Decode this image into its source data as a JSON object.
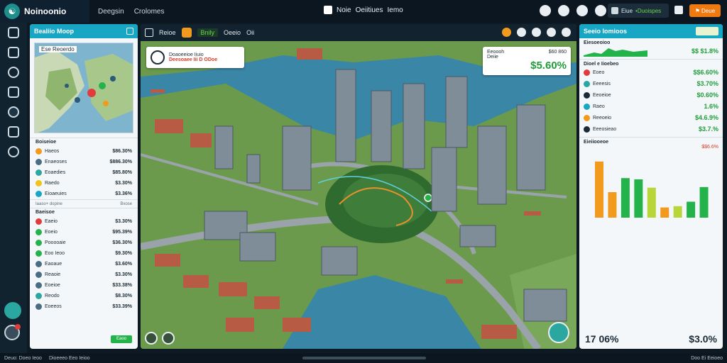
{
  "app": {
    "name": "Noinoonio",
    "nav": [
      "Deegsin",
      "Crolomes"
    ]
  },
  "header": {
    "title_a": "Noie",
    "title_b": "Oeiitiues",
    "title_c": "Iemo",
    "user_label": "Eiue",
    "user_status": "•Duoispes",
    "action_label": "Deue"
  },
  "left_panel": {
    "title": "Bealiio Moop",
    "minimap_label": "Ese Reoerdo",
    "section_a_title": "Boiseioe",
    "metrics_a": [
      {
        "label": "Haeos",
        "value": "$86.30%",
        "color": "#f29a1d"
      },
      {
        "label": "Enaeoses",
        "value": "$886.30%",
        "color": "#4a6d84"
      },
      {
        "label": "Eoaedies",
        "value": "$85.80%",
        "color": "#2aa7a0"
      },
      {
        "label": "Raedo",
        "value": "$3.30%",
        "color": "#f2c21d"
      },
      {
        "label": "Eioaeuies",
        "value": "$3.36%",
        "color": "#17a7c4"
      }
    ],
    "footer_a_left": "Iaaso+ dopine",
    "footer_a_right": "Bxose",
    "section_b_title": "Baeisoe",
    "metrics_b": [
      {
        "label": "Eaeio",
        "value": "$3.30%",
        "color": "#e23b3b"
      },
      {
        "label": "Eoeio",
        "value": "$95.39%",
        "color": "#24b24a"
      },
      {
        "label": "Pooooaie",
        "value": "$36.30%",
        "color": "#24b24a"
      },
      {
        "label": "Eoo Ieoo",
        "value": "$9.30%",
        "color": "#24b24a"
      },
      {
        "label": "Eaoaue",
        "value": "$3.60%",
        "color": "#4a6d84"
      },
      {
        "label": "Reaoie",
        "value": "$3.30%",
        "color": "#4a6d84"
      },
      {
        "label": "Eoeioe",
        "value": "$33.38%",
        "color": "#4a6d84"
      },
      {
        "label": "Reodo",
        "value": "$8.30%",
        "color": "#2aa7a0"
      },
      {
        "label": "Eoeeos",
        "value": "$33.39%",
        "color": "#4a6d84"
      }
    ],
    "button_label": "Eaoo"
  },
  "map": {
    "toolbar": [
      "Reioe",
      "Bnily",
      "Oeeio",
      "Oii"
    ],
    "callout_left": {
      "line1": "Doaoeeioe  Iiuio",
      "line2": "Deesoaee  Iii D ODoe"
    },
    "callout_right": {
      "line1": "Eeoooh",
      "value1": "$60 860",
      "line2": "Deiie",
      "big": "$5.60%"
    }
  },
  "right_panel": {
    "title": "Seeio Iomioos",
    "block1_title": "Eiesoeoioo",
    "block1_value": "$$ $1.8%",
    "block2_title": "Dioel e Iioebeo",
    "rows": [
      {
        "label": "Eoeo",
        "value": "$$6.60%"
      },
      {
        "label": "Eeeesis",
        "value": "$3.70%"
      },
      {
        "label": "Eeoeioe",
        "value": "$0.60%"
      },
      {
        "label": "Raeo",
        "value": "1.6%"
      },
      {
        "label": "Reeoeio",
        "value": "$4.6.9%"
      },
      {
        "label": "Eeeosieao",
        "value": "$3.7.%"
      }
    ],
    "chart_title": "Eieiiooeoe",
    "chart_values": [
      88,
      40,
      62,
      60,
      47,
      16,
      18,
      25,
      48
    ],
    "chart_colors": [
      "#f29a1d",
      "#f29a1d",
      "#24b24a",
      "#24b24a",
      "#b8d63a",
      "#f29a1d",
      "#b8d63a",
      "#24b24a",
      "#24b24a"
    ],
    "chart_legend": "$$6.6%",
    "bottom_left": "17 06%",
    "bottom_right": "$3.0%"
  },
  "statusbar": {
    "left1": "Deuo: Doeo Ieoo",
    "left2": "Dioeeeo Eeo Ieioo",
    "right": "Doo Ei Eeioeo"
  }
}
